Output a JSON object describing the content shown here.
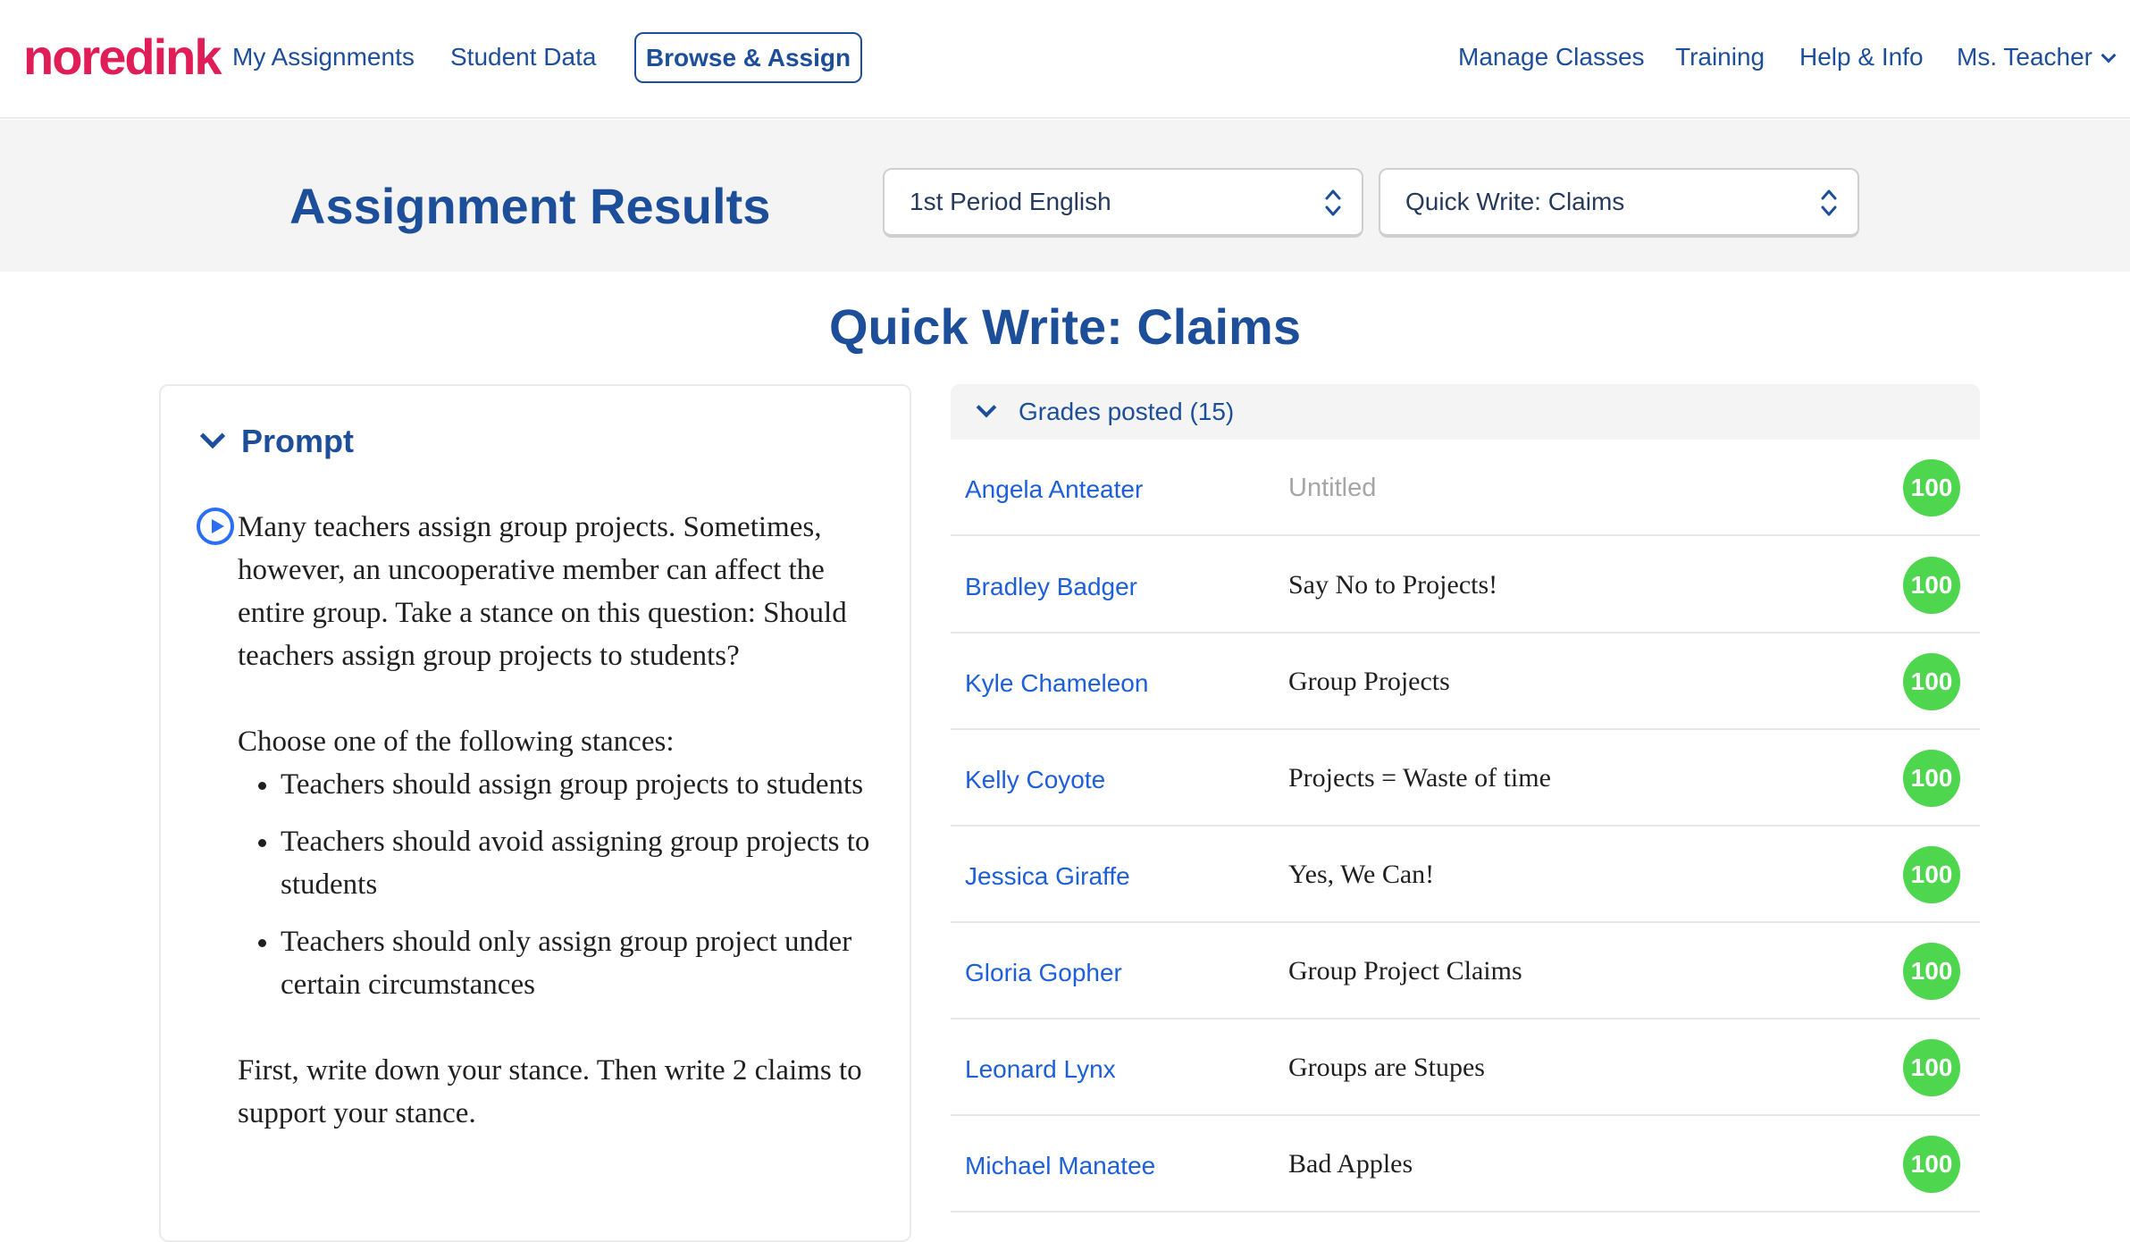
{
  "nav": {
    "logo": {
      "a": "no",
      "b": "red",
      "c": "ink"
    },
    "links_left": [
      "My Assignments",
      "Student Data"
    ],
    "active": "Browse & Assign",
    "links_right": [
      "Manage Classes",
      "Training",
      "Help & Info"
    ],
    "user": "Ms. Teacher"
  },
  "header": {
    "title": "Assignment Results",
    "class_select": "1st Period English",
    "assignment_select": "Quick Write: Claims"
  },
  "assignment_title": "Quick Write: Claims",
  "prompt": {
    "heading": "Prompt",
    "para1": "Many teachers assign group projects. Sometimes, however, an uncooperative member can affect the entire group. Take a stance on this question: Should teachers assign group projects to students?",
    "para2": "Choose one of the following stances:",
    "stances": [
      "Teachers should assign group projects to students",
      "Teachers should avoid assigning group projects to students",
      "Teachers should only assign group project under certain circumstances"
    ],
    "para3": "First, write down your stance. Then write 2 claims to support your stance."
  },
  "grades": {
    "heading": "Grades posted (15)",
    "rows": [
      {
        "student": "Angela Anteater",
        "essay": "Untitled",
        "score": "100"
      },
      {
        "student": "Bradley Badger",
        "essay": "Say No to Projects!",
        "score": "100"
      },
      {
        "student": "Kyle Chameleon",
        "essay": "Group Projects",
        "score": "100"
      },
      {
        "student": "Kelly Coyote",
        "essay": "Projects = Waste of time",
        "score": "100"
      },
      {
        "student": "Jessica Giraffe",
        "essay": "Yes, We Can!",
        "score": "100"
      },
      {
        "student": "Gloria Gopher",
        "essay": "Group Project Claims",
        "score": "100"
      },
      {
        "student": "Leonard Lynx",
        "essay": "Groups are Stupes",
        "score": "100"
      },
      {
        "student": "Michael Manatee",
        "essay": "Bad Apples",
        "score": "100"
      }
    ]
  },
  "colors": {
    "brand": "#e01d56",
    "nav_blue": "#1d4e9a",
    "link_blue": "#1d5fd8",
    "score_green": "#4fd64f"
  }
}
